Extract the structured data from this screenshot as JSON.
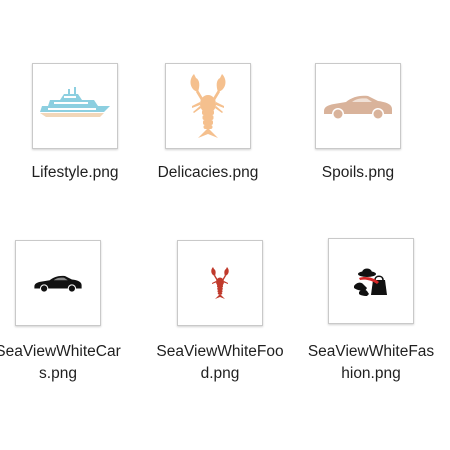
{
  "files": [
    {
      "name": "Lifestyle.png",
      "name_lines": [
        "Lifestyle.png"
      ],
      "icon": "yacht-icon",
      "color": "#8ccfe0"
    },
    {
      "name": "Delicacies.png",
      "name_lines": [
        "Delicacies.png"
      ],
      "icon": "lobster-icon",
      "color": "#f5c08e"
    },
    {
      "name": "Spoils.png",
      "name_lines": [
        "Spoils.png"
      ],
      "icon": "sports-car-icon",
      "color": "#d9b39b"
    },
    {
      "name": "SeaViewWhiteCars.png",
      "name_lines": [
        "SeaViewWhiteCar",
        "s.png"
      ],
      "icon": "sports-car-icon",
      "color": "#111111"
    },
    {
      "name": "SeaViewWhiteFood.png",
      "name_lines": [
        "SeaViewWhiteFoo",
        "d.png"
      ],
      "icon": "lobster-icon",
      "color": "#c0392b"
    },
    {
      "name": "SeaViewWhiteFashion.png",
      "name_lines": [
        "SeaViewWhiteFas",
        "hion.png"
      ],
      "icon": "fashion-accessories-icon",
      "color": "#111111",
      "accent": "#d62828"
    }
  ]
}
